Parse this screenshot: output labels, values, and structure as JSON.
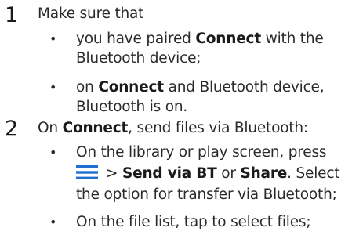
{
  "steps": [
    {
      "number": "1",
      "text": "Make sure that",
      "bullets": [
        {
          "lines": [
            {
              "pre": "you have paired ",
              "bold": "Connect",
              "post": " with the"
            },
            {
              "pre": "Bluetooth device;"
            }
          ]
        },
        {
          "lines": [
            {
              "pre": "on ",
              "bold": "Connect",
              "post": " and Bluetooth device,"
            },
            {
              "pre": "Bluetooth is on."
            }
          ]
        }
      ]
    },
    {
      "number": "2",
      "text_pre": "On ",
      "text_bold": "Connect",
      "text_post": ", send files via Bluetooth:",
      "bullets": [
        {
          "lines": [
            {
              "pre": "On the library or play screen, press"
            },
            {
              "icon": "menu-icon",
              "pre": "> ",
              "bold": "Send via BT",
              "post": " or ",
              "bold2": "Share",
              "post2": ". Select"
            },
            {
              "pre": "the option for transfer via Bluetooth;"
            }
          ]
        },
        {
          "lines": [
            {
              "pre": "On the file list, tap to select files;"
            }
          ]
        }
      ]
    }
  ],
  "bullet_char": "•",
  "colors": {
    "text": "#2a2a2a",
    "icon": "#1f6fd1"
  }
}
